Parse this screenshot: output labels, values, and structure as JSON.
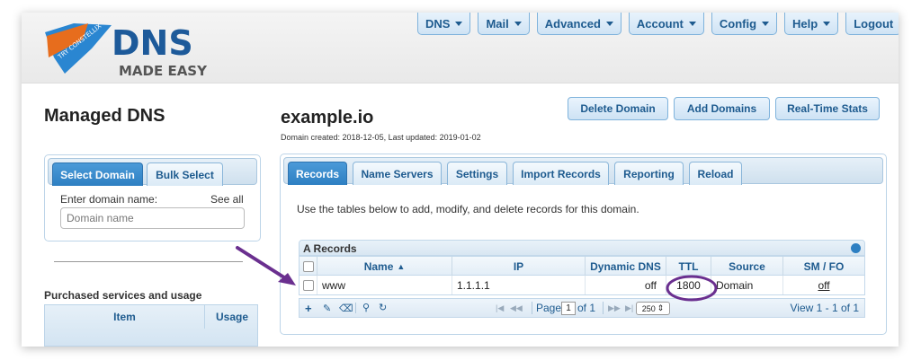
{
  "brand": {
    "logo_main": "DNS",
    "logo_sub": "MADE EASY",
    "ribbon": "TRY CONSTELLIX"
  },
  "nav": [
    "DNS",
    "Mail",
    "Advanced",
    "Account",
    "Config",
    "Help",
    "Logout"
  ],
  "left": {
    "title": "Managed DNS",
    "tabs": [
      "Select Domain",
      "Bulk Select"
    ],
    "domain_label": "Enter domain name:",
    "see_all": "See all",
    "domain_placeholder": "Domain name",
    "services_title": "Purchased services and usage",
    "services_cols": [
      "Item",
      "Usage"
    ]
  },
  "domain": {
    "name": "example.io",
    "meta": "Domain created: 2018-12-05, Last updated: 2019-01-02",
    "actions": [
      "Delete Domain",
      "Add Domains",
      "Real-Time Stats"
    ],
    "tabs": [
      "Records",
      "Name Servers",
      "Settings",
      "Import Records",
      "Reporting",
      "Reload"
    ],
    "intro": "Use the tables below to add, modify, and delete records for this domain."
  },
  "records": {
    "title": "A Records",
    "columns": [
      "Name",
      "IP",
      "Dynamic DNS",
      "TTL",
      "Source",
      "SM / FO"
    ],
    "rows": [
      {
        "name": "www",
        "ip": "1.1.1.1",
        "dynamic": "off",
        "ttl": "1800",
        "source": "Domain",
        "smfo": "off"
      }
    ],
    "pager": {
      "page_label": "Page",
      "page": "1",
      "of": "of 1",
      "per_page": "250",
      "view": "View 1 - 1 of 1"
    }
  },
  "colors": {
    "accent": "#2d7fc2",
    "link": "#1e5b8f",
    "annotation": "#6a2f8f"
  }
}
